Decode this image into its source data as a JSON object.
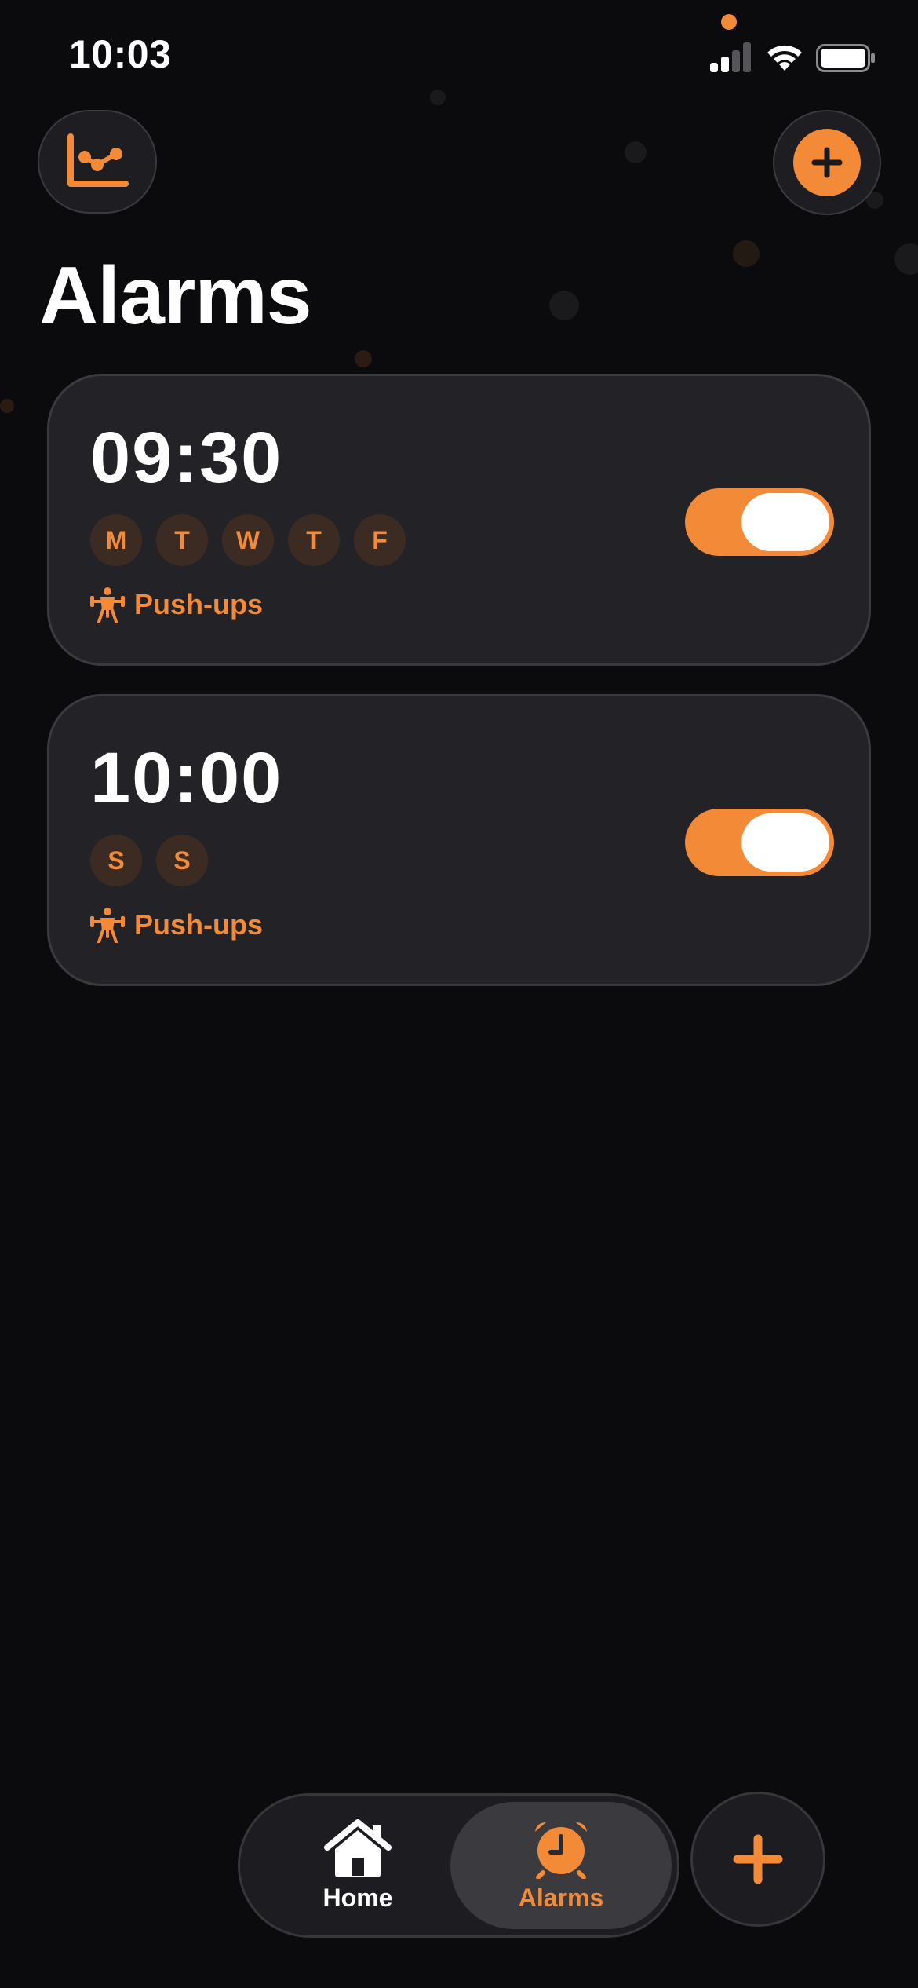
{
  "status_bar": {
    "time": "10:03"
  },
  "header": {
    "title": "Alarms",
    "stats_icon": "chart-icon",
    "add_icon": "plus-icon"
  },
  "alarms": [
    {
      "time": "09:30",
      "days": [
        "M",
        "T",
        "W",
        "T",
        "F"
      ],
      "exercise": "Push-ups",
      "enabled": true
    },
    {
      "time": "10:00",
      "days": [
        "S",
        "S"
      ],
      "exercise": "Push-ups",
      "enabled": true
    }
  ],
  "tab_bar": {
    "tabs": [
      {
        "label": "Home",
        "icon": "home-icon",
        "active": false
      },
      {
        "label": "Alarms",
        "icon": "alarm-clock-icon",
        "active": true
      }
    ],
    "fab_icon": "plus-icon"
  },
  "colors": {
    "accent": "#f28a37",
    "background": "#0b0b0d",
    "card": "#232327"
  }
}
